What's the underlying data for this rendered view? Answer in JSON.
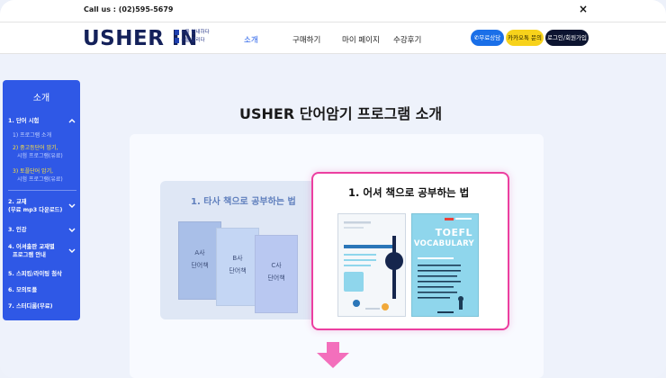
{
  "topbar": {
    "phone": "Call us : (02)595-5679",
    "close": "×"
  },
  "header": {
    "logo": "USHER IN",
    "tagline": [
      "~을 안내하다",
      "~을 알리다"
    ],
    "nav": [
      "소개",
      "구매하기",
      "마이 페이지",
      "수강후기"
    ],
    "buttons": {
      "consult": "무료상담",
      "kakao": "카카오톡 문의",
      "login": "로그인/회원가입"
    }
  },
  "sidebar": {
    "title": "소개",
    "items": [
      {
        "label": "1. 단어 시험",
        "subs": [
          "1) 프로그램 소개",
          "2) 중고등단어 암기,",
          "시험 프로그램(유료)",
          "3) 토플단어 암기,",
          "시험 프로그램(유료)"
        ]
      },
      {
        "label": "2. 교재",
        "label2": "(무료 mp3 다운로드)"
      },
      {
        "label": "3. 인강"
      },
      {
        "label": "4. 어셔출판 교재별",
        "label2": "프로그램 안내"
      },
      {
        "label": "5. 스피킹/라이팅 첨삭"
      },
      {
        "label": "6. 모의토플"
      },
      {
        "label": "7. 스터디룸(무료)"
      }
    ]
  },
  "main": {
    "title": "USHER 단어암기 프로그램 소개",
    "left_title": "1. 타사 책으로 공부하는 법",
    "books": [
      {
        "line1": "A사",
        "line2": "단어책",
        "color": "#a9bfe8"
      },
      {
        "line1": "B사",
        "line2": "단어책",
        "color": "#c4d6f4"
      },
      {
        "line1": "C사",
        "line2": "단어책",
        "color": "#b9c8f1"
      }
    ],
    "right_title": "1. 어셔 책으로 공부하는 법",
    "usher_books": [
      {
        "text": "TOEFL",
        "text2": "VOCABULARY"
      }
    ]
  },
  "colors": {
    "accent": "#1a57e8",
    "sidebar": "#2f58e6",
    "highlight": "#ec3fa0",
    "logo": "#14215a"
  }
}
